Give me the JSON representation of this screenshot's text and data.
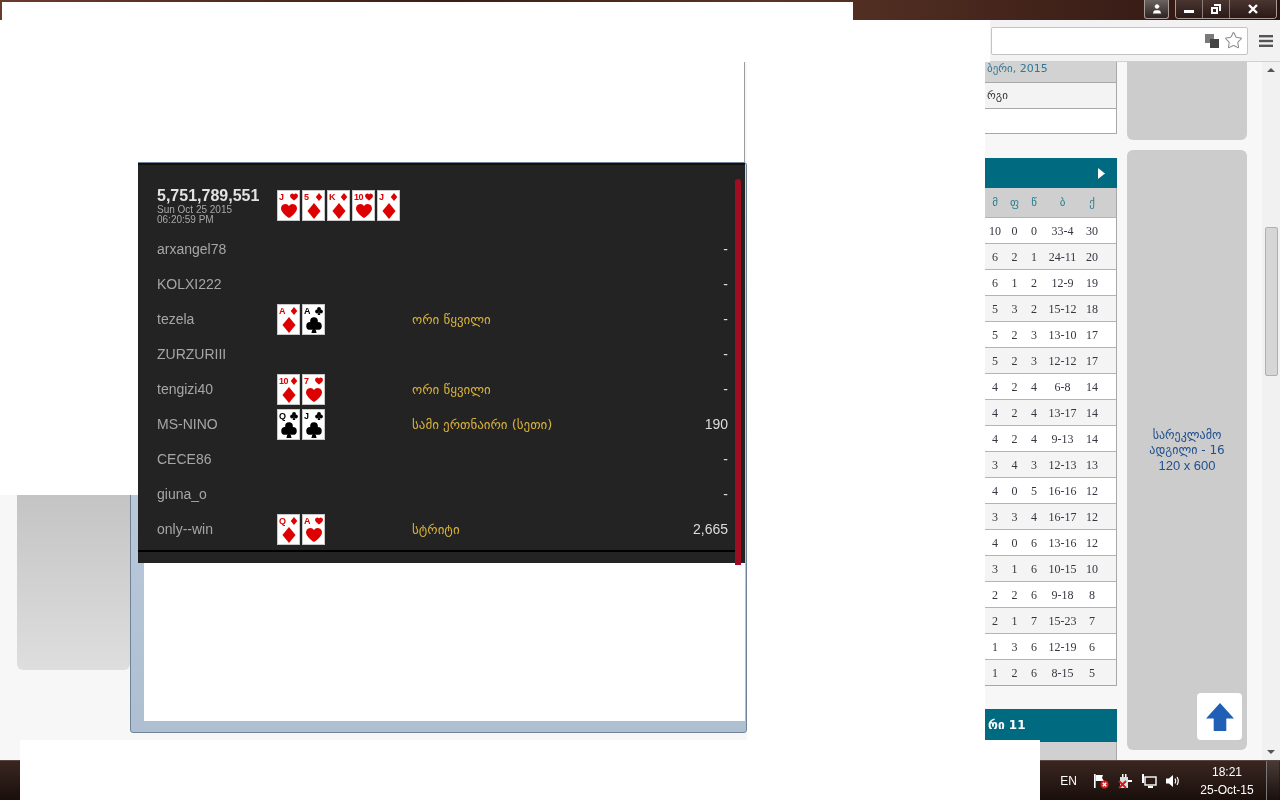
{
  "browser": {
    "info_rows": [
      "ბერი, 2015",
      "რგი"
    ],
    "standings": {
      "columns": [
        "მ",
        "ფ",
        "წ",
        "ბ",
        "ქ"
      ],
      "rows": [
        [
          "10",
          "0",
          "0",
          "33-4",
          "30"
        ],
        [
          "6",
          "2",
          "1",
          "24-11",
          "20"
        ],
        [
          "6",
          "1",
          "2",
          "12-9",
          "19"
        ],
        [
          "5",
          "3",
          "2",
          "15-12",
          "18"
        ],
        [
          "5",
          "2",
          "3",
          "13-10",
          "17"
        ],
        [
          "5",
          "2",
          "3",
          "12-12",
          "17"
        ],
        [
          "4",
          "2",
          "4",
          "6-8",
          "14"
        ],
        [
          "4",
          "2",
          "4",
          "13-17",
          "14"
        ],
        [
          "4",
          "2",
          "4",
          "9-13",
          "14"
        ],
        [
          "3",
          "4",
          "3",
          "12-13",
          "13"
        ],
        [
          "4",
          "0",
          "5",
          "16-16",
          "12"
        ],
        [
          "3",
          "3",
          "4",
          "16-17",
          "12"
        ],
        [
          "4",
          "0",
          "6",
          "13-16",
          "12"
        ],
        [
          "3",
          "1",
          "6",
          "10-15",
          "10"
        ],
        [
          "2",
          "2",
          "6",
          "9-18",
          "8"
        ],
        [
          "2",
          "1",
          "7",
          "15-23",
          "7"
        ],
        [
          "1",
          "3",
          "6",
          "12-19",
          "6"
        ],
        [
          "1",
          "2",
          "6",
          "8-15",
          "5"
        ]
      ]
    },
    "next_table": {
      "title": "რი 11"
    },
    "ad": {
      "title": "სარეკლამო ადგილი - 16",
      "size": "120 x 600"
    }
  },
  "poker": {
    "pot": "5,751,789,551",
    "date": "Sun Oct 25 2015",
    "time": "06:20:59 PM",
    "board": [
      {
        "rank": "J",
        "kind": "hearts"
      },
      {
        "rank": "5",
        "kind": "diamonds"
      },
      {
        "rank": "K",
        "kind": "diamonds"
      },
      {
        "rank": "10",
        "kind": "hearts"
      },
      {
        "rank": "J",
        "kind": "diamonds"
      }
    ],
    "players": [
      {
        "name": "arxangel78",
        "result": "-"
      },
      {
        "name": "KOLXI222",
        "result": "-"
      },
      {
        "name": "tezela",
        "cards": [
          {
            "rank": "A",
            "kind": "diamonds"
          },
          {
            "rank": "A",
            "kind": "clubs"
          }
        ],
        "hand": "ორი წყვილი",
        "result": "-"
      },
      {
        "name": "ZURZURIII",
        "result": "-"
      },
      {
        "name": "tengizi40",
        "cards": [
          {
            "rank": "10",
            "kind": "diamonds"
          },
          {
            "rank": "7",
            "kind": "hearts"
          }
        ],
        "hand": "ორი წყვილი",
        "result": "-"
      },
      {
        "name": "MS-NINO",
        "cards": [
          {
            "rank": "Q",
            "kind": "clubs"
          },
          {
            "rank": "J",
            "kind": "clubs"
          }
        ],
        "hand": "სამი ერთნაირი (სეთი)",
        "result": "190"
      },
      {
        "name": "CECE86",
        "result": "-"
      },
      {
        "name": "giuna_o",
        "result": "-"
      },
      {
        "name": "only--win",
        "cards": [
          {
            "rank": "Q",
            "kind": "diamonds"
          },
          {
            "rank": "A",
            "kind": "hearts"
          }
        ],
        "hand": "სტრიტი",
        "result": "2,665"
      }
    ]
  },
  "taskbar": {
    "language": "EN",
    "time": "18:21",
    "date": "25-Oct-15"
  }
}
